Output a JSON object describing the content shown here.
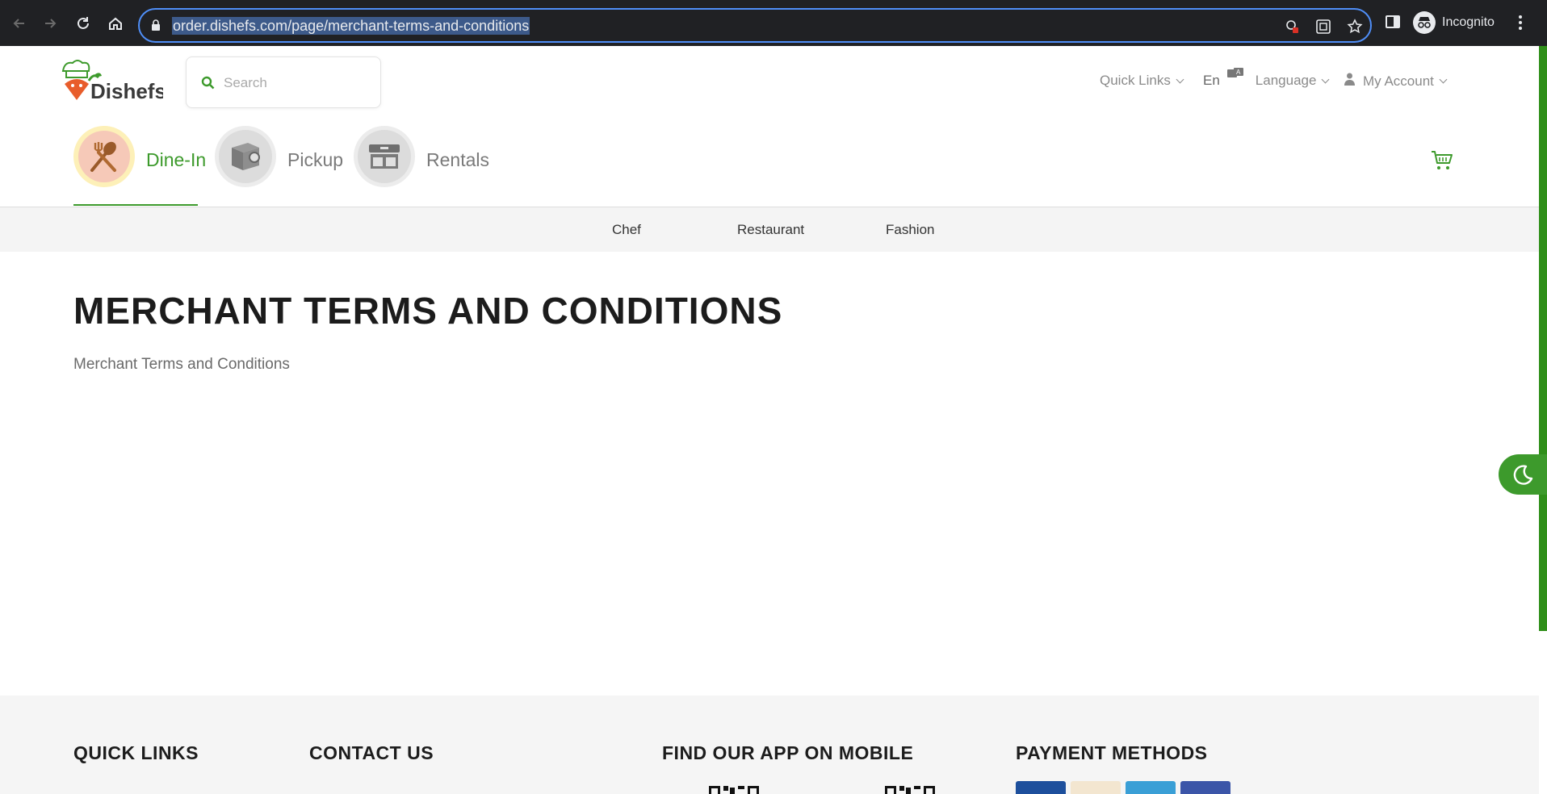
{
  "browser": {
    "url_display": "order.dishefs.com/page/merchant-terms-and-conditions",
    "profile_label": "Incognito"
  },
  "header": {
    "logo_text": "Dishefs",
    "search_placeholder": "Search",
    "quick_links_label": "Quick Links",
    "lang_code": "En",
    "language_label": "Language",
    "account_label": "My Account"
  },
  "services": [
    {
      "label": "Dine-In",
      "icon": "fork-spoon-icon",
      "active": true
    },
    {
      "label": "Pickup",
      "icon": "package-icon",
      "active": false
    },
    {
      "label": "Rentals",
      "icon": "storefront-icon",
      "active": false
    }
  ],
  "categories": [
    "Chef",
    "Restaurant",
    "Fashion"
  ],
  "content": {
    "title": "MERCHANT TERMS AND CONDITIONS",
    "body": "Merchant Terms and Conditions"
  },
  "footer": {
    "quick_links_heading": "QUICK LINKS",
    "contact_heading": "CONTACT US",
    "app_heading": "FIND OUR APP ON MOBILE",
    "payment_heading": "PAYMENT METHODS"
  },
  "colors": {
    "brand_green": "#3d9a2c",
    "browser_bg": "#202124",
    "url_focus": "#4f8ef7"
  }
}
